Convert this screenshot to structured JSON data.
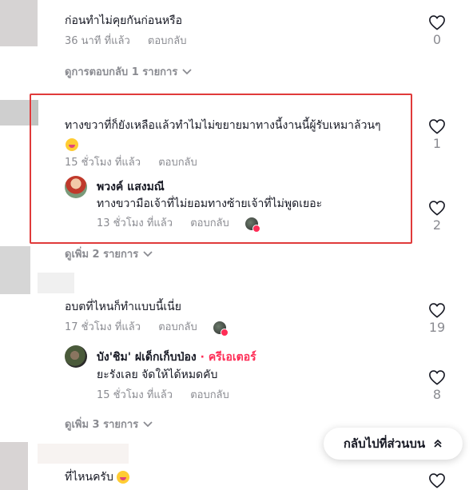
{
  "comments": [
    {
      "text": "ก่อนทำไม่คุยกันก่อนหรือ",
      "time": "36 นาที ที่แล้ว",
      "reply": "ตอบกลับ",
      "likes": "0",
      "view_replies": "ดูการตอบกลับ 1 รายการ"
    },
    {
      "text": "ทางขวาที่ก็ยังเหลือแล้วทำไมไม่ขยายมาทางนี้งานนี้ผู้รับเหมาล้วนๆ",
      "time": "15 ชั่วโมง ที่แล้ว",
      "reply": "ตอบกลับ",
      "likes": "1",
      "sub_reply": {
        "name": "พวงค์ แสงมณี",
        "text": "ทางขวามือเจ้าที่ไม่ยอมทางซ้ายเจ้าที่ไม่พูดเยอะ",
        "time": "13 ชั่วโมง ที่แล้ว",
        "reply": "ตอบกลับ",
        "likes": "2"
      },
      "view_more": "ดูเพิ่ม 2 รายการ"
    },
    {
      "text": "อบตที่ไหนก็ทำแบบนี้เนี่ย",
      "time": "17 ชั่วโมง ที่แล้ว",
      "reply": "ตอบกลับ",
      "likes": "19",
      "sub_reply": {
        "name": "บัง'ชิม' ฝเด็กเก็บป่อง",
        "creator_label": "· ครีเอเตอร์",
        "text": "ยะรังเลย จัดให้ได้หมดคับ",
        "time": "15 ชั่วโมง ที่แล้ว",
        "reply": "ตอบกลับ",
        "likes": "8"
      },
      "view_more": "ดูเพิ่ม 3 รายการ"
    },
    {
      "text": "ที่ไหนครับ"
    }
  ],
  "back_to_top": "กลับไปที่ส่วนบน",
  "colors": {
    "highlight_box": "#e03a3a",
    "creator": "#fe2c55",
    "muted": "#8a8b91"
  }
}
